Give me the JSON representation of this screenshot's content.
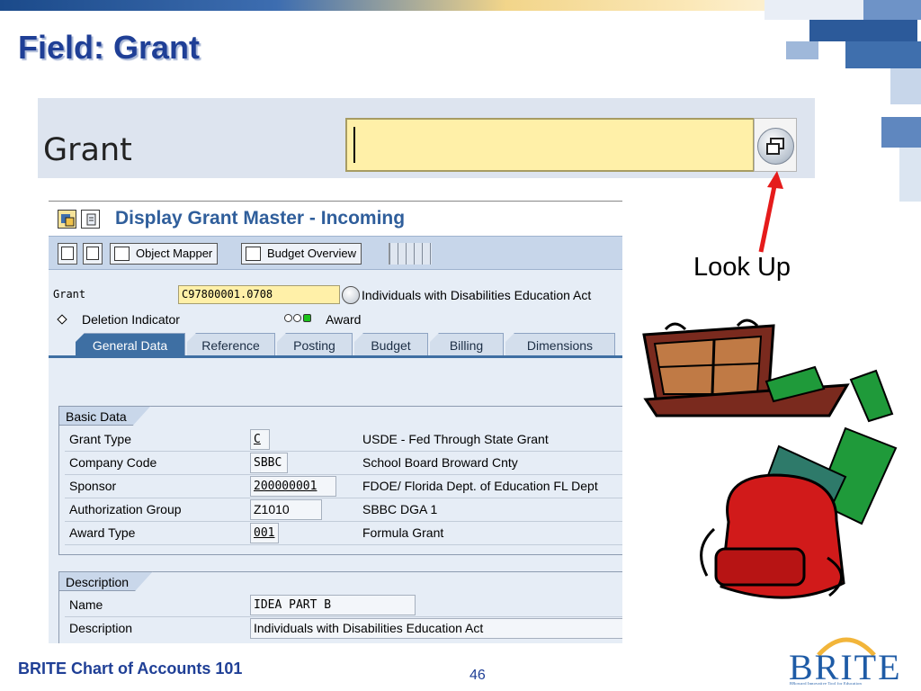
{
  "slide": {
    "title": "Field: Grant",
    "annotation": "Look Up",
    "footer": "BRITE Chart of Accounts 101",
    "page_number": "46",
    "logo": {
      "word": "BRITE",
      "tagline": "BRoward Innovative Tool for Education"
    }
  },
  "zoom_field": {
    "label": "Grant",
    "value": ""
  },
  "sap": {
    "title": "Display Grant Master - Incoming",
    "toolbar": {
      "object_mapper": "Object Mapper",
      "budget_overview": "Budget Overview"
    },
    "header": {
      "grant_label": "Grant",
      "grant_value": "C97800001.0708",
      "grant_desc": "Individuals with Disabilities Education Act",
      "deletion_indicator": "Deletion Indicator",
      "award": "Award"
    },
    "tabs": [
      {
        "label": "General Data",
        "active": true
      },
      {
        "label": "Reference",
        "active": false
      },
      {
        "label": "Posting",
        "active": false
      },
      {
        "label": "Budget",
        "active": false
      },
      {
        "label": "Billing",
        "active": false
      },
      {
        "label": "Dimensions",
        "active": false
      }
    ],
    "basic_data": {
      "title": "Basic Data",
      "rows": [
        {
          "label": "Grant Type",
          "value": "C",
          "desc": "USDE - Fed Through State Grant"
        },
        {
          "label": "Company Code",
          "value": "SBBC",
          "desc": "School Board Broward Cnty"
        },
        {
          "label": "Sponsor",
          "value": "200000001",
          "desc": "FDOE/ Florida Dept. of Education FL Dept"
        },
        {
          "label": "Authorization Group",
          "value": "Z1010",
          "desc": "SBBC DGA 1"
        },
        {
          "label": "Award Type",
          "value": "001",
          "desc": "Formula Grant"
        }
      ]
    },
    "description": {
      "title": "Description",
      "rows": [
        {
          "label": "Name",
          "value": "IDEA PART B"
        },
        {
          "label": "Description",
          "value": "Individuals with Disabilities Education Act"
        }
      ]
    }
  },
  "colors": {
    "title_blue": "#1f3f96",
    "input_yellow": "#fff0a8",
    "tab_active": "#3e6fa3",
    "arrow_red": "#e51b1b"
  },
  "icons": [
    "lookup-icon",
    "sap-display-icon",
    "object-mapper-icon",
    "budget-overview-icon",
    "deletion-diamond-icon",
    "award-lamp-icon",
    "briefcase-money-clipart",
    "backpack-book-clipart"
  ]
}
